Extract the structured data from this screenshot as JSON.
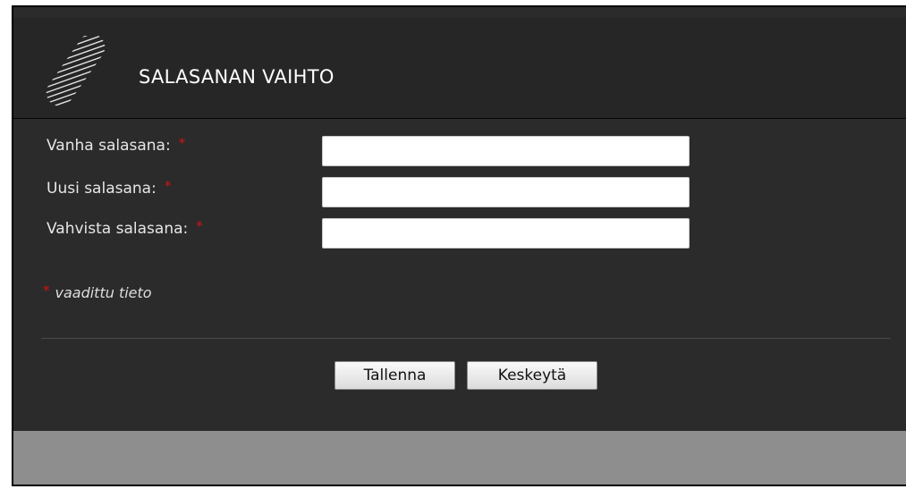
{
  "dialog": {
    "title": "SALASANAN VAIHTO",
    "logo_icon": "striped-pill-logo-icon"
  },
  "form": {
    "fields": [
      {
        "label": "Vanha salasana:",
        "required_mark": "*",
        "value": ""
      },
      {
        "label": "Uusi salasana:",
        "required_mark": "*",
        "value": ""
      },
      {
        "label": "Vahvista salasana:",
        "required_mark": "*",
        "value": ""
      }
    ],
    "required_note": {
      "mark": "*",
      "text": "vaadittu tieto"
    }
  },
  "buttons": {
    "save_label": "Tallenna",
    "cancel_label": "Keskeytä"
  },
  "colors": {
    "background": "#2b2b2b",
    "required_star": "#d21414",
    "footer": "#8e8e8e"
  }
}
